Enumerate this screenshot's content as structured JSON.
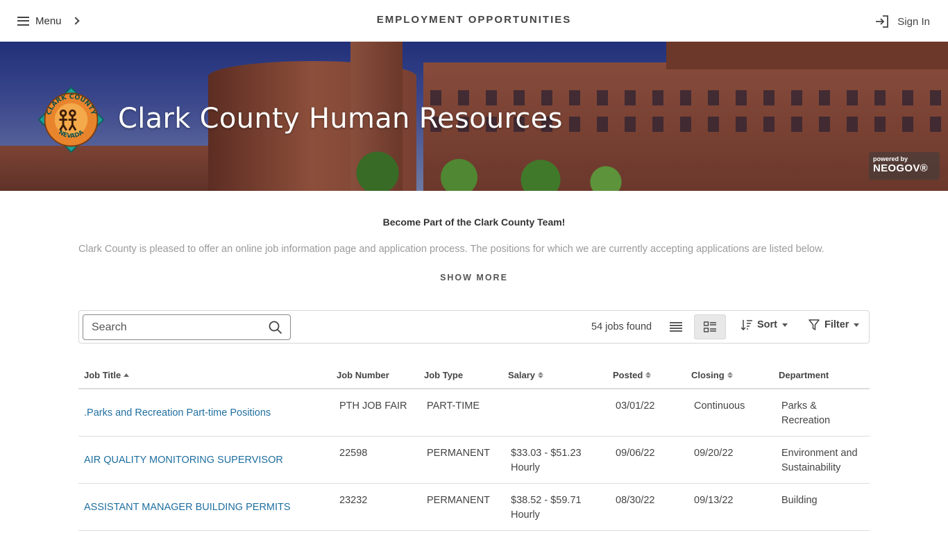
{
  "header": {
    "menu_label": "Menu",
    "page_heading": "EMPLOYMENT OPPORTUNITIES",
    "signin_label": "Sign In"
  },
  "banner": {
    "title": "Clark County Human Resources",
    "logo_text_top": "CLARK COUNTY",
    "logo_text_bottom": "NEVADA",
    "powered_by": "powered by",
    "neogov": "NEOGOV®"
  },
  "intro": {
    "title": "Become Part of the Clark County Team!",
    "text": "Clark County is pleased to offer an online job information page and application process. The positions for which we are currently accepting applications are listed below.",
    "show_more": "SHOW MORE"
  },
  "toolbar": {
    "search_placeholder": "Search",
    "jobs_found": "54 jobs found",
    "sort_label": "Sort",
    "filter_label": "Filter"
  },
  "table": {
    "headers": {
      "title": "Job Title",
      "number": "Job Number",
      "type": "Job Type",
      "salary": "Salary",
      "posted": "Posted",
      "closing": "Closing",
      "department": "Department"
    },
    "rows": [
      {
        "title": ".Parks and Recreation Part-time Positions",
        "number": "PTH JOB FAIR",
        "type": "PART-TIME",
        "salary_line1": "",
        "salary_line2": "",
        "posted": "03/01/22",
        "closing": "Continuous",
        "dept_line1": "Parks &",
        "dept_line2": "Recreation"
      },
      {
        "title": "AIR QUALITY MONITORING SUPERVISOR",
        "number": "22598",
        "type": "PERMANENT",
        "salary_line1": "$33.03 - $51.23",
        "salary_line2": "Hourly",
        "posted": "09/06/22",
        "closing": "09/20/22",
        "dept_line1": "Environment and",
        "dept_line2": "Sustainability"
      },
      {
        "title": "ASSISTANT MANAGER BUILDING PERMITS",
        "number": "23232",
        "type": "PERMANENT",
        "salary_line1": "$38.52 - $59.71",
        "salary_line2": "Hourly",
        "posted": "08/30/22",
        "closing": "09/13/22",
        "dept_line1": "Building",
        "dept_line2": ""
      }
    ]
  },
  "colors": {
    "link": "#1f6fa0",
    "muted_text": "#9a9a9a",
    "logo_teal": "#1aa39a",
    "logo_orange": "#e8842c"
  }
}
